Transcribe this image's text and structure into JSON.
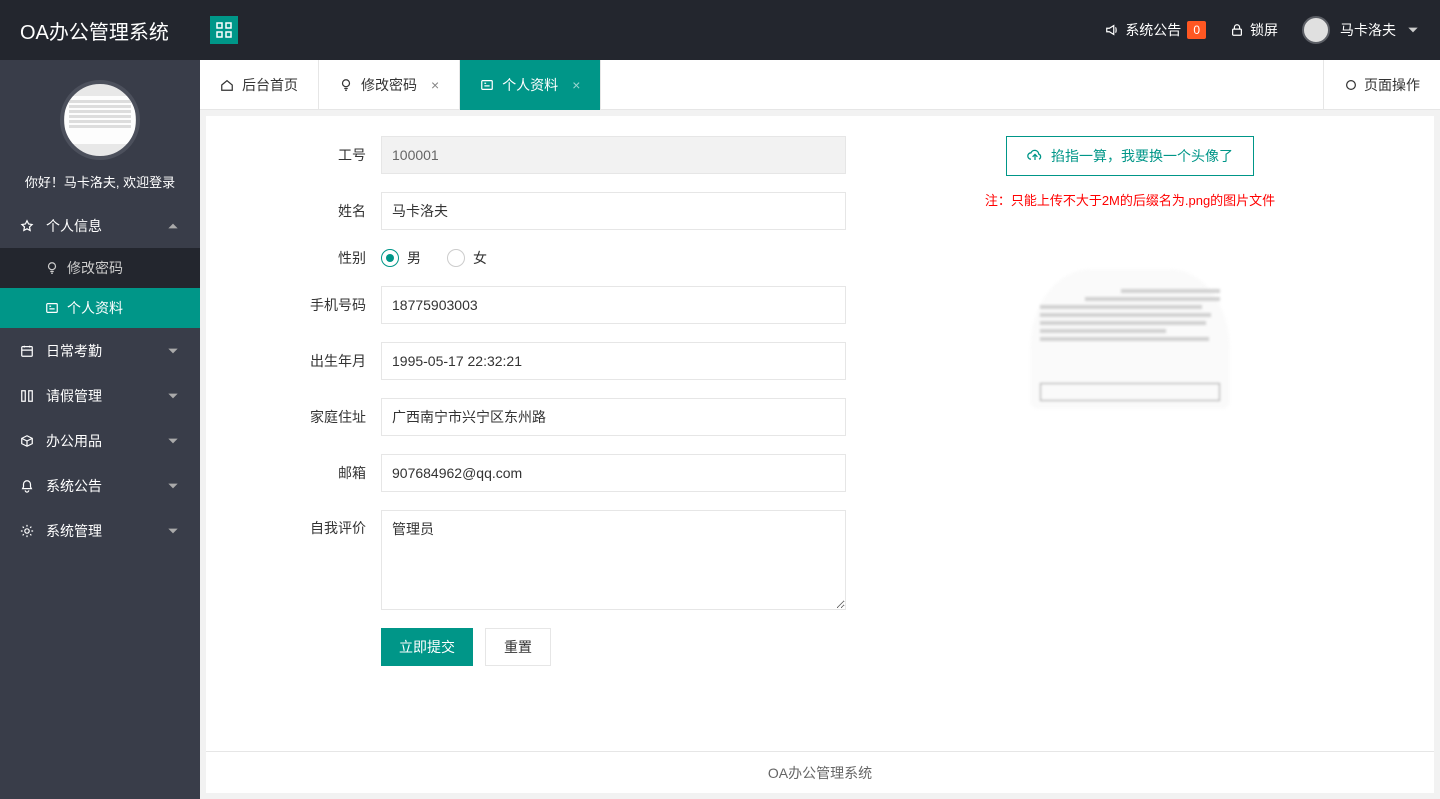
{
  "header": {
    "logo": "OA办公管理系统",
    "announce": "系统公告",
    "announce_count": "0",
    "lock": "锁屏",
    "username": "马卡洛夫"
  },
  "sidebar": {
    "greeting": "你好！马卡洛夫, 欢迎登录",
    "groups": {
      "personal": {
        "title": "个人信息",
        "items": [
          "修改密码",
          "个人资料"
        ]
      },
      "attend": {
        "title": "日常考勤"
      },
      "leave": {
        "title": "请假管理"
      },
      "supply": {
        "title": "办公用品"
      },
      "notice": {
        "title": "系统公告"
      },
      "sys": {
        "title": "系统管理"
      }
    }
  },
  "tabs": {
    "home": "后台首页",
    "pwd": "修改密码",
    "profile": "个人资料",
    "page_ops": "页面操作"
  },
  "form": {
    "labels": {
      "emp_no": "工号",
      "name": "姓名",
      "gender": "性别",
      "phone": "手机号码",
      "birth": "出生年月",
      "addr": "家庭住址",
      "email": "邮箱",
      "self": "自我评价"
    },
    "values": {
      "emp_no": "100001",
      "name": "马卡洛夫",
      "phone": "18775903003",
      "birth": "1995-05-17 22:32:21",
      "addr": "广西南宁市兴宁区东州路",
      "email": "907684962@qq.com",
      "self": "管理员"
    },
    "gender": {
      "male": "男",
      "female": "女",
      "selected": "male"
    },
    "buttons": {
      "submit": "立即提交",
      "reset": "重置"
    }
  },
  "upload": {
    "button": "掐指一算，我要换一个头像了",
    "note": "注：只能上传不大于2M的后缀名为.png的图片文件"
  },
  "footer": "OA办公管理系统"
}
